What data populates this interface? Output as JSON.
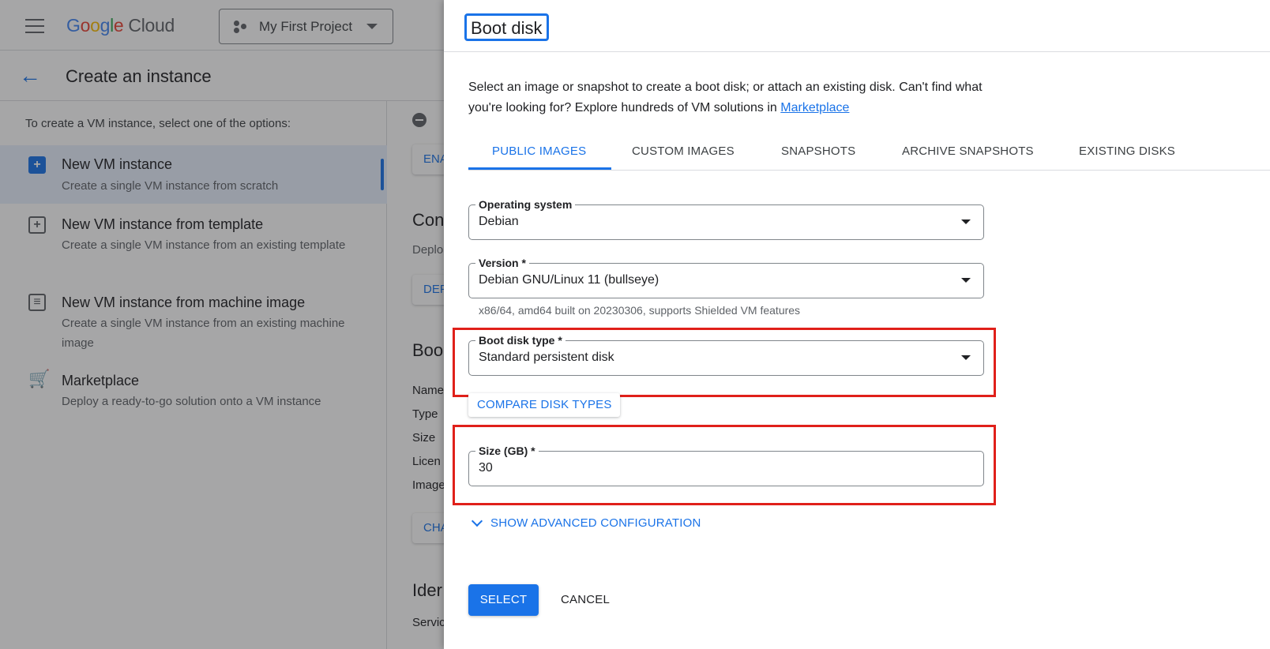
{
  "topbar": {
    "brand_cloud": "Cloud",
    "project_name": "My First Project"
  },
  "subheader": {
    "title": "Create an instance"
  },
  "left_pane": {
    "intro": "To create a VM instance, select one of the options:",
    "options": [
      {
        "title": "New VM instance",
        "desc": "Create a single VM instance from scratch",
        "icon": "add-box-icon",
        "selected": true
      },
      {
        "title": "New VM instance from template",
        "desc": "Create a single VM instance from an existing template",
        "icon": "template-add-icon",
        "selected": false
      },
      {
        "title": "New VM instance from machine image",
        "desc": "Create a single VM instance from an existing machine image",
        "icon": "machine-image-icon",
        "selected": false
      },
      {
        "title": "Marketplace",
        "desc": "Deploy a ready-to-go solution onto a VM instance",
        "icon": "shopping-cart-icon",
        "selected": false
      }
    ]
  },
  "mid_pane": {
    "enable_btn": "ENA",
    "section1_heading": "Con",
    "section1_text": "Deplo",
    "deploy_btn": "DEF",
    "section2_heading": "Boo",
    "labels": [
      "Name",
      "Type",
      "Size",
      "Licen",
      "Image"
    ],
    "change_btn": "CHA",
    "section3_heading": "Ider",
    "service_label": "Servic"
  },
  "panel": {
    "title": "Boot disk",
    "description": "Select an image or snapshot to create a boot disk; or attach an existing disk. Can't find what you're looking for? Explore hundreds of VM solutions in",
    "marketplace_link": "Marketplace",
    "tabs": [
      "PUBLIC IMAGES",
      "CUSTOM IMAGES",
      "SNAPSHOTS",
      "ARCHIVE SNAPSHOTS",
      "EXISTING DISKS"
    ],
    "active_tab": "PUBLIC IMAGES",
    "operating_system": {
      "label": "Operating system",
      "value": "Debian"
    },
    "version": {
      "label": "Version *",
      "value": "Debian GNU/Linux 11 (bullseye)",
      "hint": "x86/64, amd64 built on 20230306, supports Shielded VM features"
    },
    "boot_disk_type": {
      "label": "Boot disk type *",
      "value": "Standard persistent disk"
    },
    "compare_btn": "COMPARE DISK TYPES",
    "size": {
      "label": "Size (GB) *",
      "value": "30"
    },
    "advanced_link": "SHOW ADVANCED CONFIGURATION",
    "select_btn": "SELECT",
    "cancel_btn": "CANCEL"
  },
  "colors": {
    "accent": "#1a73e8",
    "highlight": "#e0201a"
  }
}
